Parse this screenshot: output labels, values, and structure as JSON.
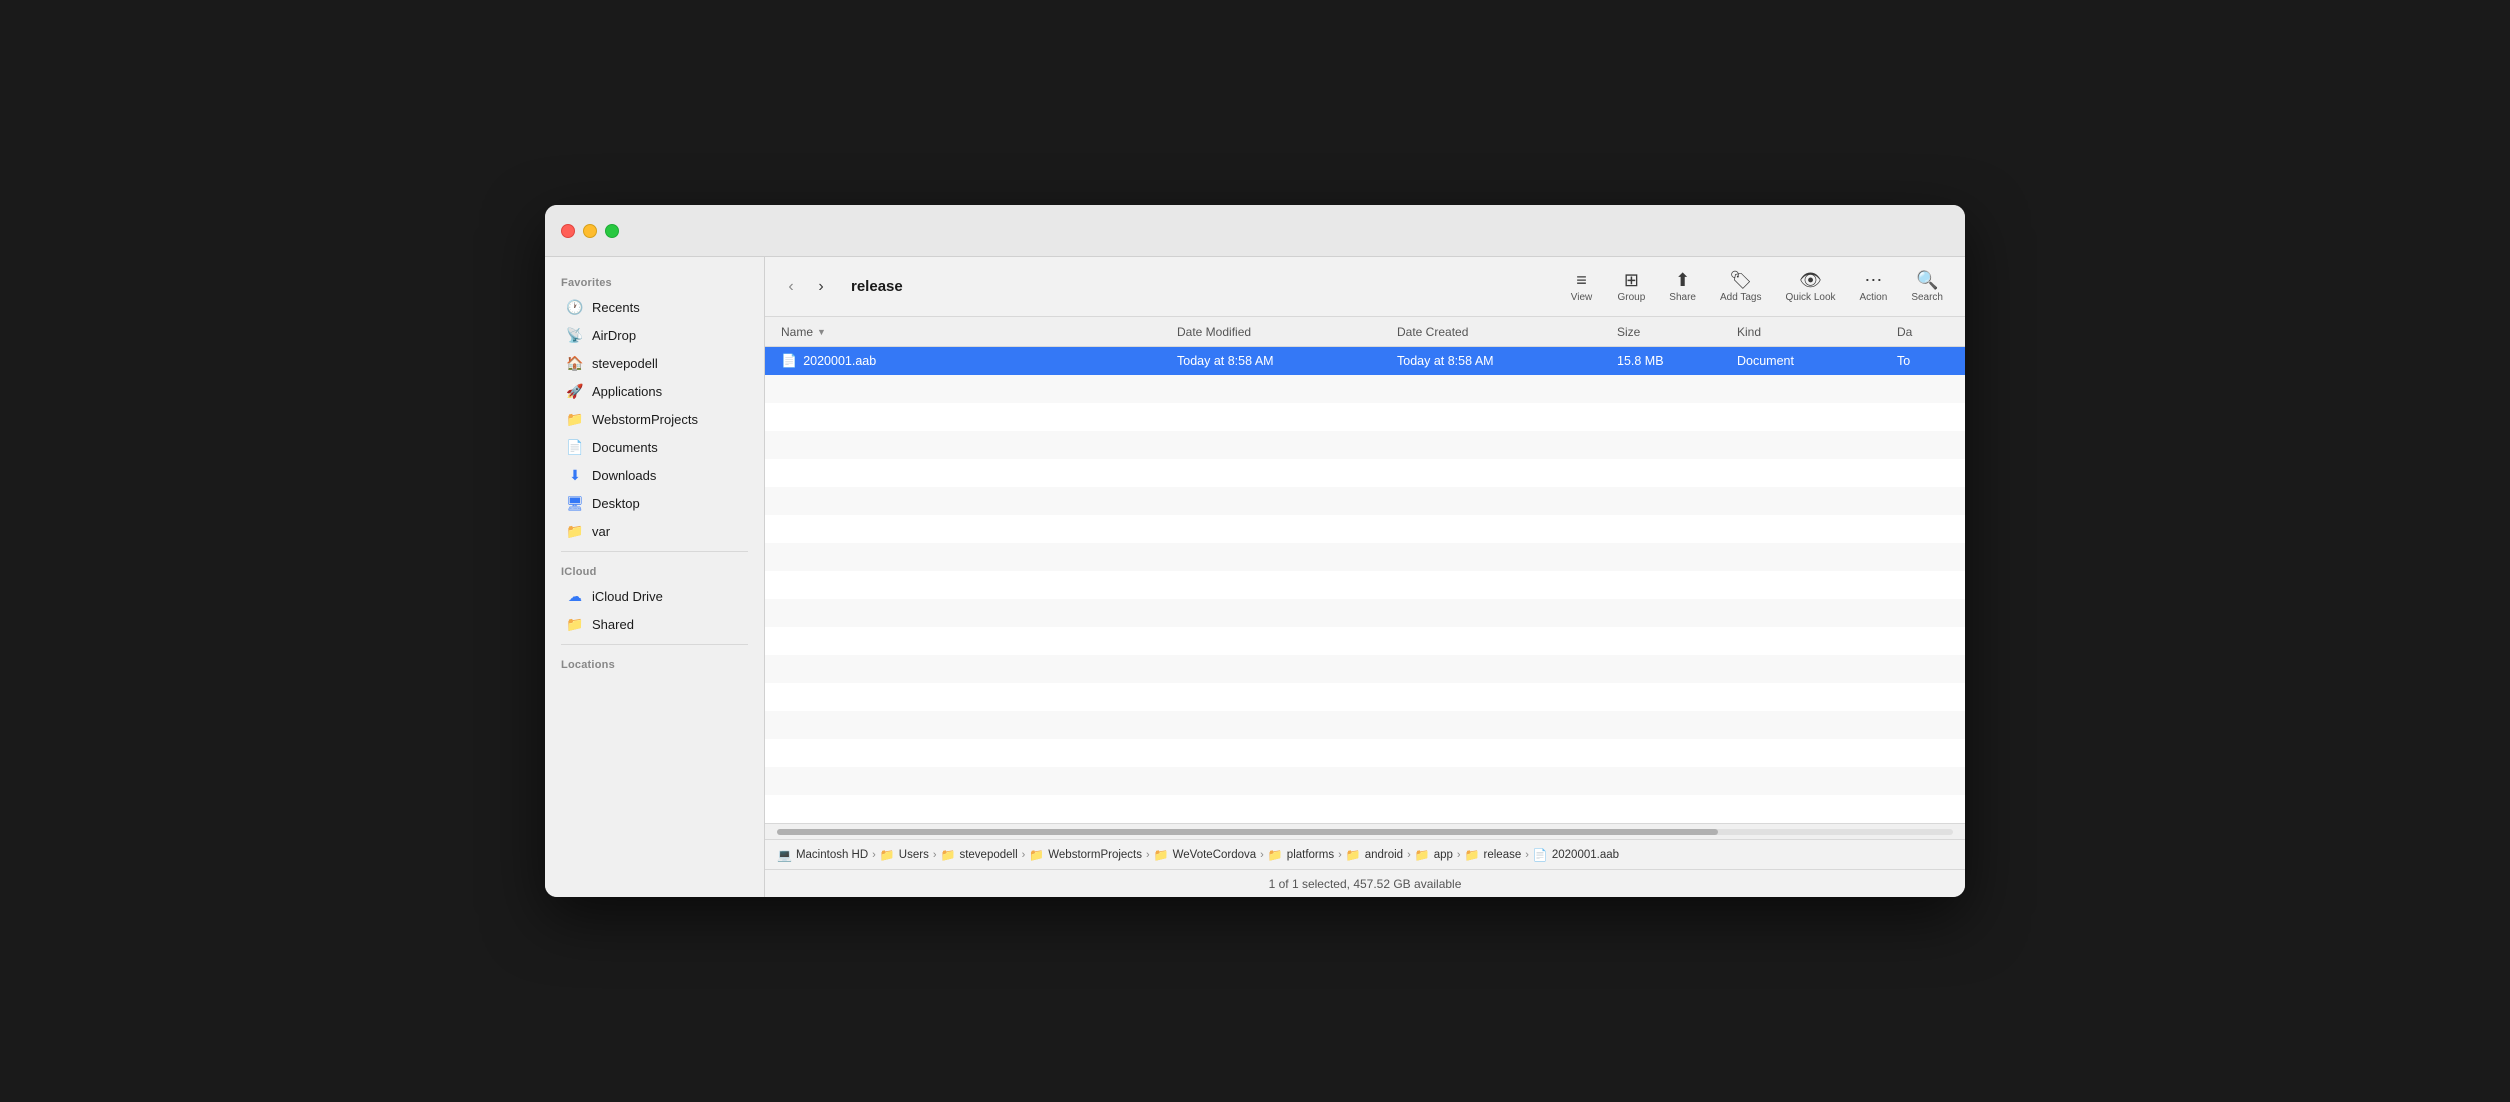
{
  "window": {
    "title": "release"
  },
  "toolbar": {
    "back_label": "Back/Forward",
    "view_label": "View",
    "group_label": "Group",
    "share_label": "Share",
    "add_tags_label": "Add Tags",
    "quick_look_label": "Quick Look",
    "action_label": "Action",
    "search_label": "Search"
  },
  "columns": {
    "name": "Name",
    "date_modified": "Date Modified",
    "date_created": "Date Created",
    "size": "Size",
    "kind": "Kind",
    "da": "Da"
  },
  "files": [
    {
      "name": "2020001.aab",
      "date_modified": "Today at 8:58 AM",
      "date_created": "Today at 8:58 AM",
      "size": "15.8 MB",
      "kind": "Document",
      "da": "To",
      "selected": true
    }
  ],
  "sidebar": {
    "sections": [
      {
        "label": "Favorites",
        "items": [
          {
            "icon": "🕐",
            "label": "Recents"
          },
          {
            "icon": "📡",
            "label": "AirDrop"
          },
          {
            "icon": "🏠",
            "label": "stevepodell"
          },
          {
            "icon": "🚀",
            "label": "Applications"
          },
          {
            "icon": "📁",
            "label": "WebstormProjects"
          },
          {
            "icon": "📄",
            "label": "Documents"
          },
          {
            "icon": "⬇",
            "label": "Downloads"
          },
          {
            "icon": "🖥",
            "label": "Desktop"
          },
          {
            "icon": "📁",
            "label": "var"
          }
        ]
      },
      {
        "label": "iCloud",
        "items": [
          {
            "icon": "☁",
            "label": "iCloud Drive"
          },
          {
            "icon": "📁",
            "label": "Shared"
          }
        ]
      },
      {
        "label": "Locations",
        "items": []
      }
    ]
  },
  "path": [
    {
      "icon": "💻",
      "label": "Macintosh HD"
    },
    {
      "icon": "📁",
      "label": "Users"
    },
    {
      "icon": "📁",
      "label": "stevepodell"
    },
    {
      "icon": "📁",
      "label": "WebstormProjects"
    },
    {
      "icon": "📁",
      "label": "WeVoteCordova"
    },
    {
      "icon": "📁",
      "label": "platforms"
    },
    {
      "icon": "📁",
      "label": "android"
    },
    {
      "icon": "📁",
      "label": "app"
    },
    {
      "icon": "📁",
      "label": "release"
    },
    {
      "icon": "📄",
      "label": "2020001.aab"
    }
  ],
  "status": {
    "text": "1 of 1 selected, 457.52 GB available"
  }
}
